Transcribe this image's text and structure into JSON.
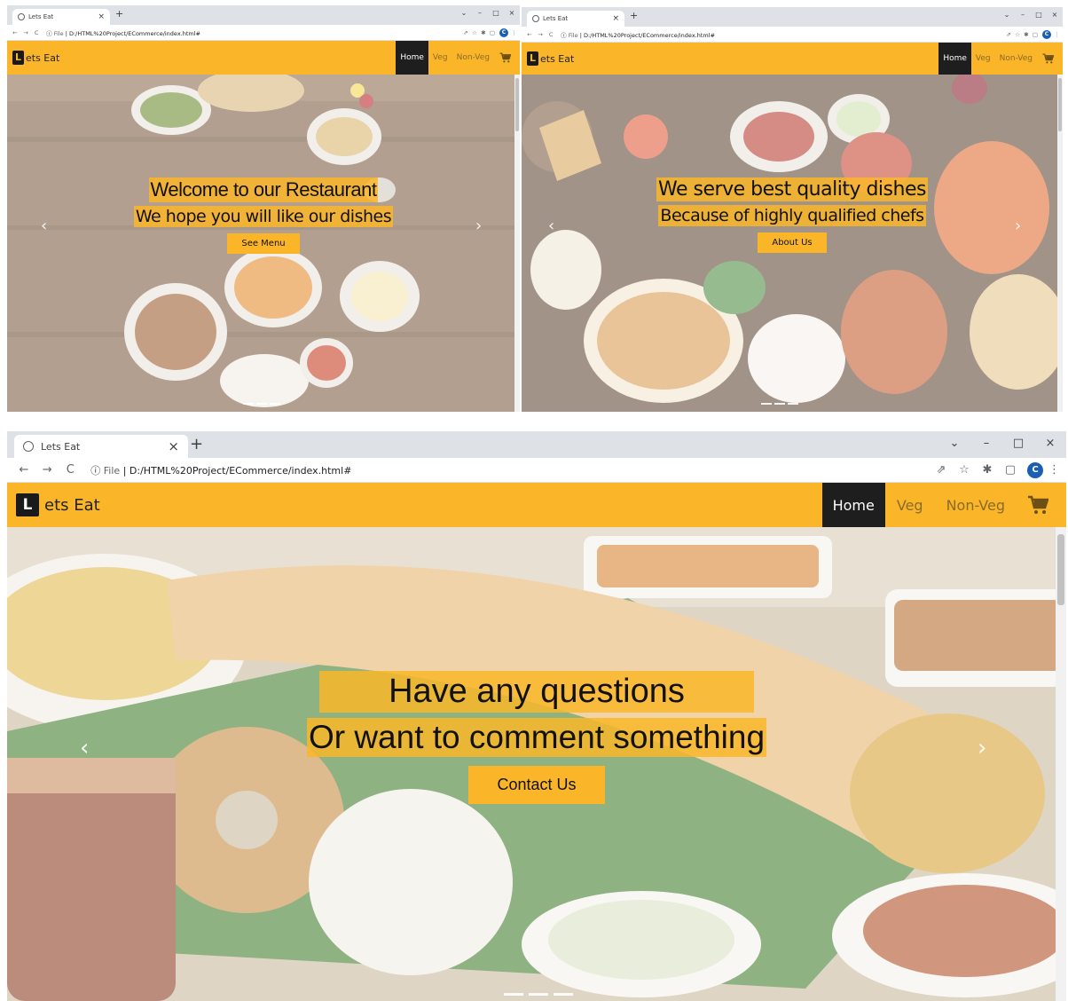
{
  "browser": {
    "tab_title_small_1": "Lets Eat",
    "tab_title_small_2": "Lets Eat",
    "tab_title": "Lets Eat",
    "close_tab": "×",
    "new_tab": "+",
    "back": "←",
    "forward": "→",
    "reload": "C",
    "site_info_label": "File",
    "url": "D:/HTML%20Project/ECommerce/index.html#",
    "profile_initial": "C",
    "window_controls": {
      "minimize": "–",
      "maximize": "□",
      "close": "×",
      "tab_search": "⌄"
    },
    "ext_icons": {
      "share": "⇗",
      "star": "☆",
      "puzzle": "✱",
      "sidebar": "▢",
      "menu": "⋮"
    }
  },
  "site": {
    "brand_letter": "L",
    "brand_rest": "ets Eat",
    "nav": {
      "home": "Home",
      "veg": "Veg",
      "nonveg": "Non-Veg"
    },
    "accent_color": "#fab628"
  },
  "slides": [
    {
      "line1": "Welcome to our Restaurant",
      "line2": "We hope you will like our dishes",
      "button": "See Menu"
    },
    {
      "line1": "We serve best quality dishes",
      "line2": "Because of highly qualified chefs",
      "button": "About Us"
    },
    {
      "line1": "Have any questions",
      "line2": "Or want to comment something",
      "button": "Contact Us"
    }
  ],
  "carousel": {
    "prev": "‹",
    "next": "›"
  }
}
